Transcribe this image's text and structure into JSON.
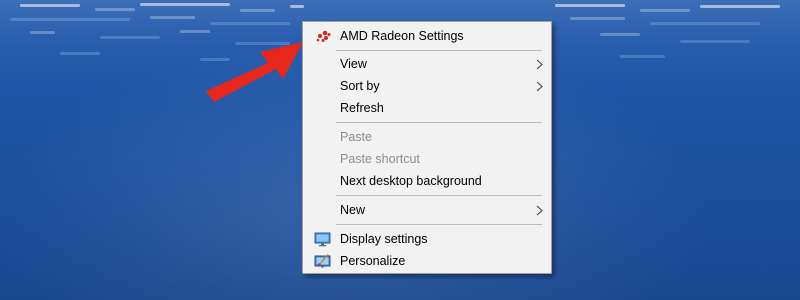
{
  "context_menu": {
    "top_item": {
      "label": "AMD Radeon Settings",
      "icon": "amd-radeon-icon"
    },
    "group_view": [
      {
        "label": "View",
        "has_submenu": true
      },
      {
        "label": "Sort by",
        "has_submenu": true
      },
      {
        "label": "Refresh",
        "has_submenu": false
      }
    ],
    "group_clipboard": [
      {
        "label": "Paste",
        "disabled": true
      },
      {
        "label": "Paste shortcut",
        "disabled": true
      },
      {
        "label": "Next desktop background",
        "disabled": false
      }
    ],
    "group_new": [
      {
        "label": "New",
        "has_submenu": true
      }
    ],
    "group_display": [
      {
        "label": "Display settings",
        "icon": "monitor-icon"
      },
      {
        "label": "Personalize",
        "icon": "personalize-icon"
      }
    ]
  },
  "colors": {
    "arrow": "#e8271c",
    "menu_background": "#f2f2f2",
    "disabled_text": "#8d8d8d",
    "desktop_blue": "#1f56a7"
  }
}
